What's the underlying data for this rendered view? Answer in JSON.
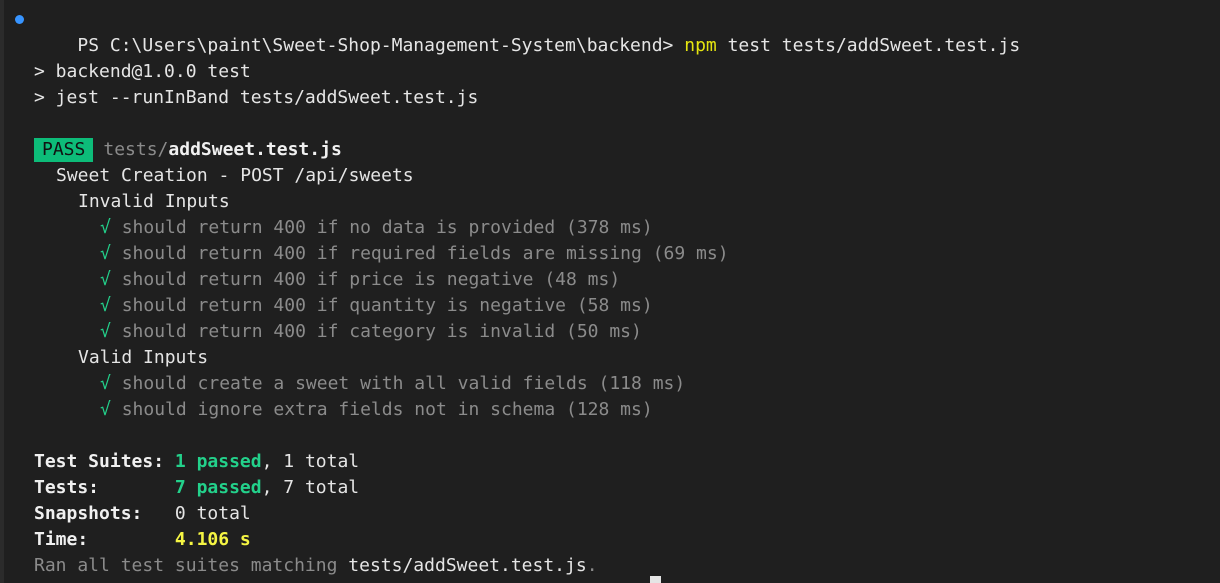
{
  "prompt": {
    "path": "PS C:\\Users\\paint\\Sweet-Shop-Management-System\\backend>",
    "command": "npm",
    "args": "test tests/addSweet.test.js"
  },
  "script_lines": [
    "> backend@1.0.0 test",
    "> jest --runInBand tests/addSweet.test.js"
  ],
  "result": {
    "badge": "PASS",
    "file_dir": "tests/",
    "file_name": "addSweet.test.js"
  },
  "suite": {
    "title": "Sweet Creation - POST /api/sweets",
    "groups": [
      {
        "title": "Invalid Inputs",
        "tests": [
          "should return 400 if no data is provided (378 ms)",
          "should return 400 if required fields are missing (69 ms)",
          "should return 400 if price is negative (48 ms)",
          "should return 400 if quantity is negative (58 ms)",
          "should return 400 if category is invalid (50 ms)"
        ]
      },
      {
        "title": "Valid Inputs",
        "tests": [
          "should create a sweet with all valid fields (118 ms)",
          "should ignore extra fields not in schema (128 ms)"
        ]
      }
    ],
    "check_mark": "√"
  },
  "summary": {
    "suites_label": "Test Suites:",
    "suites_passed": "1 passed",
    "suites_total": ", 1 total",
    "tests_label": "Tests:",
    "tests_passed": "7 passed",
    "tests_total": ", 7 total",
    "snapshots_label": "Snapshots:",
    "snapshots_value": "0 total",
    "time_label": "Time:",
    "time_value": "4.106 s",
    "ran_prefix": "Ran all test suites matching ",
    "ran_file": "tests/addSweet.test.js",
    "ran_suffix": "."
  },
  "colors": {
    "background": "#1f1f1f",
    "pass_badge": "#0dbc79",
    "green": "#23d18b",
    "yellow": "#f5f543",
    "prompt_dot": "#3794ff"
  }
}
